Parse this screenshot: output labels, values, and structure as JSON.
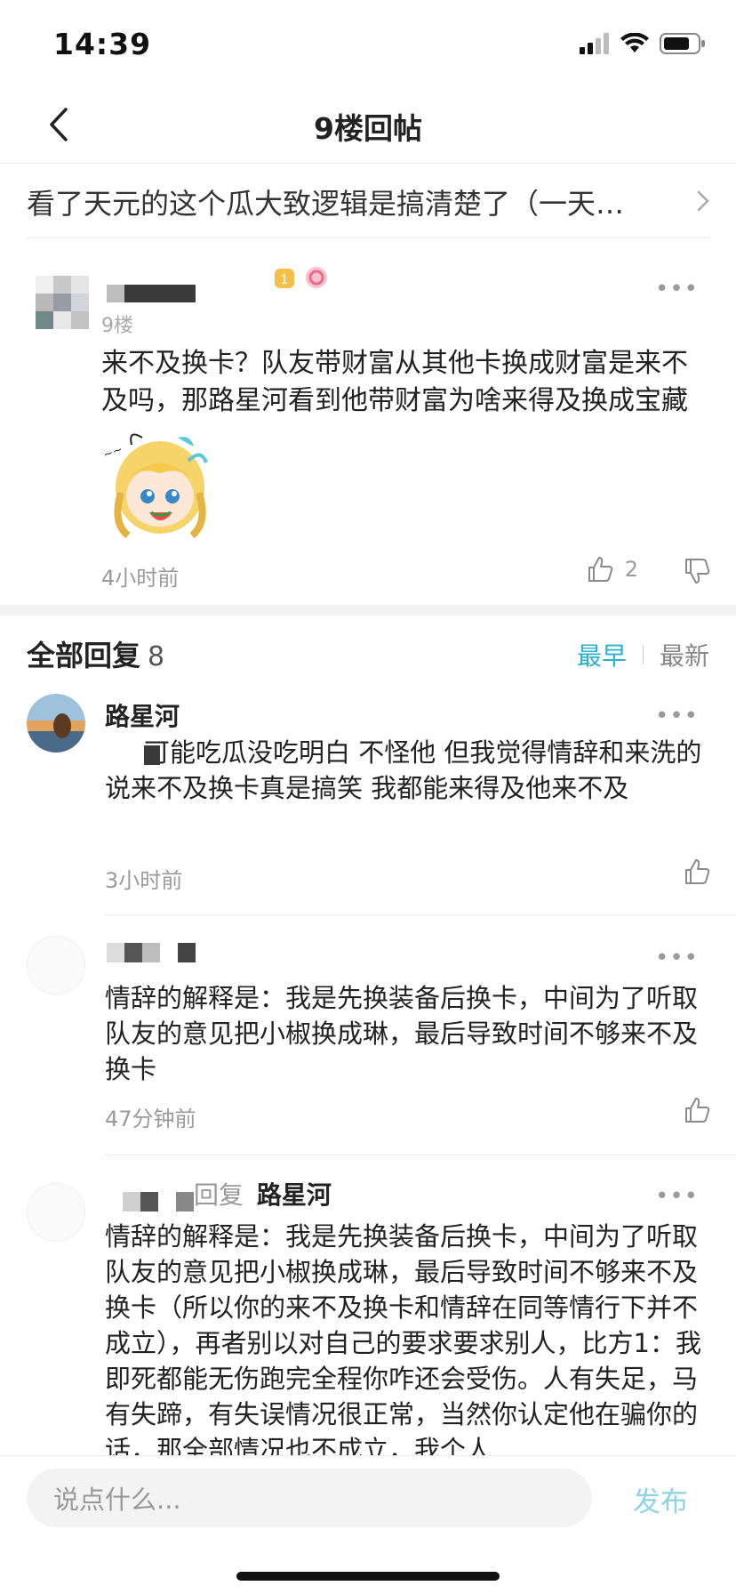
{
  "status_bar": {
    "time": "14:39"
  },
  "nav": {
    "title": "9楼回帖",
    "back_icon": "chevron-left-icon"
  },
  "thread_link": {
    "text": "看了天元的这个瓜大致逻辑是搞清楚了（一天…"
  },
  "post": {
    "floor": "9楼",
    "content": "来不及换卡？队友带财富从其他卡换成财富是来不及吗，那路星河看到他带财富为啥来得及换成宝藏",
    "time": "4小时前",
    "likes": "2"
  },
  "replies_section": {
    "title": "全部回复",
    "count": "8",
    "sort_early": "最早",
    "sort_new": "最新"
  },
  "replies": [
    {
      "name": "路星河",
      "content": "可能吃瓜没吃明白 不怪他 但我觉得情辞和来洗的说来不及换卡真是搞笑 我都能来得及他来不及",
      "time": "3小时前"
    },
    {
      "name": "",
      "content": "情辞的解释是：我是先换装备后换卡，中间为了听取队友的意见把小椒换成琳，最后导致时间不够来不及换卡",
      "time": "47分钟前"
    },
    {
      "reply_prefix": "回复",
      "reply_to": "路星河",
      "content": "情辞的解释是：我是先换装备后换卡，中间为了听取队友的意见把小椒换成琳，最后导致时间不够来不及换卡（所以你的来不及换卡和情辞在同等情行下并不成立），再者别以对自己的要求要求别人，比方1：我即死都能无伤跑完全程你咋还会受伤。人有失足，马有失蹄，有失误情况很正常，当然你认定他在骗你的话，那全部情况也不成立，我个人"
    }
  ],
  "bottom_bar": {
    "input_placeholder": "说点什么...",
    "publish_label": "发布"
  },
  "colors": {
    "accent": "#29b1d0",
    "publish": "#8fd3e3",
    "muted": "#9a9a9a"
  }
}
